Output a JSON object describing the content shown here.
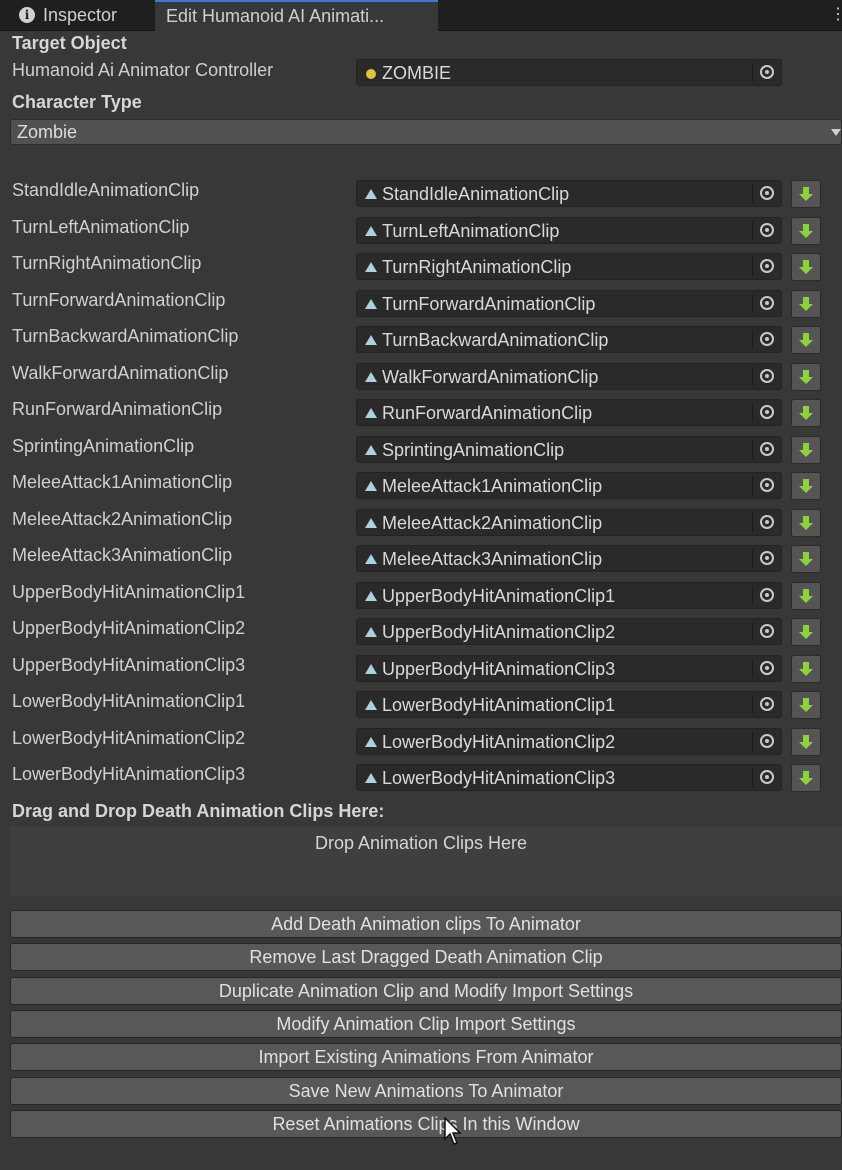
{
  "tabs": {
    "inspector": "Inspector",
    "edit": "Edit Humanoid AI Animati..."
  },
  "kebab": "⋮",
  "target_object": {
    "header": "Target Object",
    "controller_label": "Humanoid Ai Animator Controller",
    "controller_value": "ZOMBIE"
  },
  "character_type": {
    "header": "Character Type",
    "value": "Zombie"
  },
  "clips": [
    {
      "label": "StandIdleAnimationClip",
      "value": "StandIdleAnimationClip"
    },
    {
      "label": "TurnLeftAnimationClip",
      "value": "TurnLeftAnimationClip"
    },
    {
      "label": "TurnRightAnimationClip",
      "value": "TurnRightAnimationClip"
    },
    {
      "label": "TurnForwardAnimationClip",
      "value": "TurnForwardAnimationClip"
    },
    {
      "label": "TurnBackwardAnimationClip",
      "value": "TurnBackwardAnimationClip"
    },
    {
      "label": "WalkForwardAnimationClip",
      "value": "WalkForwardAnimationClip"
    },
    {
      "label": "RunForwardAnimationClip",
      "value": "RunForwardAnimationClip"
    },
    {
      "label": "SprintingAnimationClip",
      "value": "SprintingAnimationClip"
    },
    {
      "label": "MeleeAttack1AnimationClip",
      "value": "MeleeAttack1AnimationClip"
    },
    {
      "label": "MeleeAttack2AnimationClip",
      "value": "MeleeAttack2AnimationClip"
    },
    {
      "label": "MeleeAttack3AnimationClip",
      "value": "MeleeAttack3AnimationClip"
    },
    {
      "label": "UpperBodyHitAnimationClip1",
      "value": "UpperBodyHitAnimationClip1"
    },
    {
      "label": "UpperBodyHitAnimationClip2",
      "value": "UpperBodyHitAnimationClip2"
    },
    {
      "label": "UpperBodyHitAnimationClip3",
      "value": "UpperBodyHitAnimationClip3"
    },
    {
      "label": "LowerBodyHitAnimationClip1",
      "value": "LowerBodyHitAnimationClip1"
    },
    {
      "label": "LowerBodyHitAnimationClip2",
      "value": "LowerBodyHitAnimationClip2"
    },
    {
      "label": "LowerBodyHitAnimationClip3",
      "value": "LowerBodyHitAnimationClip3"
    }
  ],
  "death_section": {
    "header": "Drag and Drop Death Animation Clips Here:",
    "drop_text": "Drop Animation Clips Here"
  },
  "buttons": [
    "Add Death Animation clips To Animator",
    "Remove Last Dragged Death Animation Clip",
    "Duplicate Animation Clip and Modify Import Settings",
    "Modify Animation Clip Import Settings",
    "Import Existing Animations From Animator",
    "Save New Animations To Animator",
    "Reset Animations Clips In this Window"
  ],
  "colors": {
    "background": "#383838",
    "tab_bar": "#1f1f1f",
    "field": "#2a2a2a",
    "button": "#585858",
    "accent_arrow": "#8fd13c",
    "object_dot": "#e2c23a"
  }
}
